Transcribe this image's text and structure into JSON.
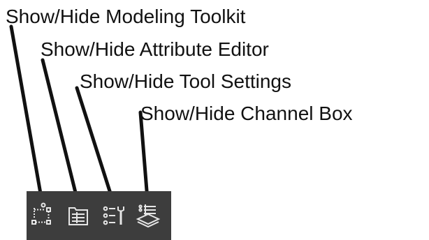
{
  "callouts": {
    "modeling_toolkit": "Show/Hide Modeling Toolkit",
    "attribute_editor": "Show/Hide Attribute Editor",
    "tool_settings": "Show/Hide Tool Settings",
    "channel_box": "Show/Hide Channel Box"
  },
  "toolbar": {
    "background_color": "#3d3d3d",
    "icon_color": "#e6e6e6",
    "buttons": [
      {
        "icon": "modeling-toolkit-icon"
      },
      {
        "icon": "attribute-editor-icon"
      },
      {
        "icon": "tool-settings-icon"
      },
      {
        "icon": "channel-box-icon"
      }
    ]
  },
  "leader_color": "#111111"
}
